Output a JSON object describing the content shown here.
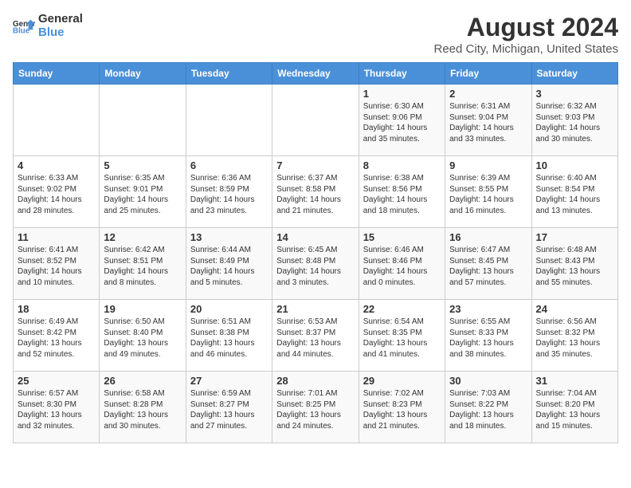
{
  "header": {
    "logo_general": "General",
    "logo_blue": "Blue",
    "title": "August 2024",
    "subtitle": "Reed City, Michigan, United States"
  },
  "calendar": {
    "days_of_week": [
      "Sunday",
      "Monday",
      "Tuesday",
      "Wednesday",
      "Thursday",
      "Friday",
      "Saturday"
    ],
    "weeks": [
      [
        {
          "day": "",
          "info": ""
        },
        {
          "day": "",
          "info": ""
        },
        {
          "day": "",
          "info": ""
        },
        {
          "day": "",
          "info": ""
        },
        {
          "day": "1",
          "info": "Sunrise: 6:30 AM\nSunset: 9:06 PM\nDaylight: 14 hours and 35 minutes."
        },
        {
          "day": "2",
          "info": "Sunrise: 6:31 AM\nSunset: 9:04 PM\nDaylight: 14 hours and 33 minutes."
        },
        {
          "day": "3",
          "info": "Sunrise: 6:32 AM\nSunset: 9:03 PM\nDaylight: 14 hours and 30 minutes."
        }
      ],
      [
        {
          "day": "4",
          "info": "Sunrise: 6:33 AM\nSunset: 9:02 PM\nDaylight: 14 hours and 28 minutes."
        },
        {
          "day": "5",
          "info": "Sunrise: 6:35 AM\nSunset: 9:01 PM\nDaylight: 14 hours and 25 minutes."
        },
        {
          "day": "6",
          "info": "Sunrise: 6:36 AM\nSunset: 8:59 PM\nDaylight: 14 hours and 23 minutes."
        },
        {
          "day": "7",
          "info": "Sunrise: 6:37 AM\nSunset: 8:58 PM\nDaylight: 14 hours and 21 minutes."
        },
        {
          "day": "8",
          "info": "Sunrise: 6:38 AM\nSunset: 8:56 PM\nDaylight: 14 hours and 18 minutes."
        },
        {
          "day": "9",
          "info": "Sunrise: 6:39 AM\nSunset: 8:55 PM\nDaylight: 14 hours and 16 minutes."
        },
        {
          "day": "10",
          "info": "Sunrise: 6:40 AM\nSunset: 8:54 PM\nDaylight: 14 hours and 13 minutes."
        }
      ],
      [
        {
          "day": "11",
          "info": "Sunrise: 6:41 AM\nSunset: 8:52 PM\nDaylight: 14 hours and 10 minutes."
        },
        {
          "day": "12",
          "info": "Sunrise: 6:42 AM\nSunset: 8:51 PM\nDaylight: 14 hours and 8 minutes."
        },
        {
          "day": "13",
          "info": "Sunrise: 6:44 AM\nSunset: 8:49 PM\nDaylight: 14 hours and 5 minutes."
        },
        {
          "day": "14",
          "info": "Sunrise: 6:45 AM\nSunset: 8:48 PM\nDaylight: 14 hours and 3 minutes."
        },
        {
          "day": "15",
          "info": "Sunrise: 6:46 AM\nSunset: 8:46 PM\nDaylight: 14 hours and 0 minutes."
        },
        {
          "day": "16",
          "info": "Sunrise: 6:47 AM\nSunset: 8:45 PM\nDaylight: 13 hours and 57 minutes."
        },
        {
          "day": "17",
          "info": "Sunrise: 6:48 AM\nSunset: 8:43 PM\nDaylight: 13 hours and 55 minutes."
        }
      ],
      [
        {
          "day": "18",
          "info": "Sunrise: 6:49 AM\nSunset: 8:42 PM\nDaylight: 13 hours and 52 minutes."
        },
        {
          "day": "19",
          "info": "Sunrise: 6:50 AM\nSunset: 8:40 PM\nDaylight: 13 hours and 49 minutes."
        },
        {
          "day": "20",
          "info": "Sunrise: 6:51 AM\nSunset: 8:38 PM\nDaylight: 13 hours and 46 minutes."
        },
        {
          "day": "21",
          "info": "Sunrise: 6:53 AM\nSunset: 8:37 PM\nDaylight: 13 hours and 44 minutes."
        },
        {
          "day": "22",
          "info": "Sunrise: 6:54 AM\nSunset: 8:35 PM\nDaylight: 13 hours and 41 minutes."
        },
        {
          "day": "23",
          "info": "Sunrise: 6:55 AM\nSunset: 8:33 PM\nDaylight: 13 hours and 38 minutes."
        },
        {
          "day": "24",
          "info": "Sunrise: 6:56 AM\nSunset: 8:32 PM\nDaylight: 13 hours and 35 minutes."
        }
      ],
      [
        {
          "day": "25",
          "info": "Sunrise: 6:57 AM\nSunset: 8:30 PM\nDaylight: 13 hours and 32 minutes."
        },
        {
          "day": "26",
          "info": "Sunrise: 6:58 AM\nSunset: 8:28 PM\nDaylight: 13 hours and 30 minutes."
        },
        {
          "day": "27",
          "info": "Sunrise: 6:59 AM\nSunset: 8:27 PM\nDaylight: 13 hours and 27 minutes."
        },
        {
          "day": "28",
          "info": "Sunrise: 7:01 AM\nSunset: 8:25 PM\nDaylight: 13 hours and 24 minutes."
        },
        {
          "day": "29",
          "info": "Sunrise: 7:02 AM\nSunset: 8:23 PM\nDaylight: 13 hours and 21 minutes."
        },
        {
          "day": "30",
          "info": "Sunrise: 7:03 AM\nSunset: 8:22 PM\nDaylight: 13 hours and 18 minutes."
        },
        {
          "day": "31",
          "info": "Sunrise: 7:04 AM\nSunset: 8:20 PM\nDaylight: 13 hours and 15 minutes."
        }
      ]
    ]
  }
}
